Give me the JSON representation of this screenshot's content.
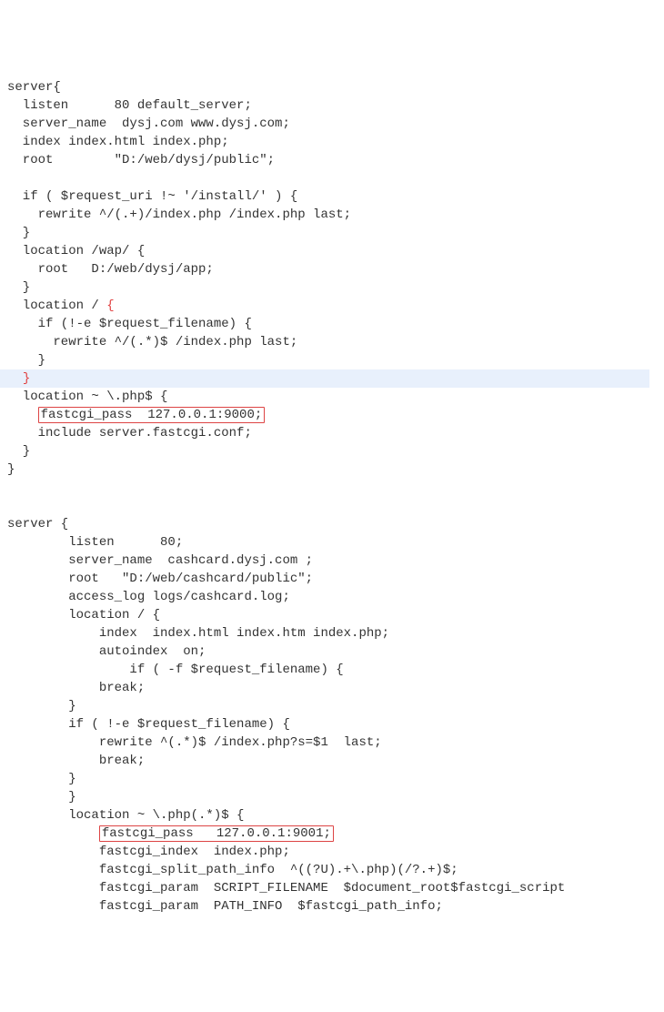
{
  "lines": [
    {
      "t": "server{"
    },
    {
      "t": "  listen      80 default_server;"
    },
    {
      "t": "  server_name  dysj.com www.dysj.com;"
    },
    {
      "t": "  index index.html index.php;"
    },
    {
      "t": "  root        \"D:/web/dysj/public\";"
    },
    {
      "t": ""
    },
    {
      "t": "  if ( $request_uri !~ '/install/' ) {"
    },
    {
      "t": "    rewrite ^/(.+)/index.php /index.php last;"
    },
    {
      "t": "  }"
    },
    {
      "t": "  location /wap/ {"
    },
    {
      "t": "    root   D:/web/dysj/app;"
    },
    {
      "t": "  }"
    },
    {
      "t": "  location / ",
      "after": "{",
      "afterClass": "red-brace"
    },
    {
      "t": "    if (!-e $request_filename) {"
    },
    {
      "t": "      rewrite ^/(.*)$ /index.php last;"
    },
    {
      "t": "    }"
    },
    {
      "t": "  ",
      "after": "}",
      "afterClass": "red-brace",
      "highlight": true
    },
    {
      "t": "  location ~ \\.php$ {"
    },
    {
      "prefix": "    ",
      "boxed": "fastcgi_pass  127.0.0.1:9000;"
    },
    {
      "t": "    include server.fastcgi.conf;"
    },
    {
      "t": "  }"
    },
    {
      "t": "}"
    },
    {
      "t": ""
    },
    {
      "t": ""
    },
    {
      "t": "server {"
    },
    {
      "t": "        listen      80;"
    },
    {
      "t": "        server_name  cashcard.dysj.com ;"
    },
    {
      "t": "        root   \"D:/web/cashcard/public\";"
    },
    {
      "t": "        access_log logs/cashcard.log;"
    },
    {
      "t": "        location / {"
    },
    {
      "t": "            index  index.html index.htm index.php;"
    },
    {
      "t": "            autoindex  on;"
    },
    {
      "t": "                if ( -f $request_filename) {"
    },
    {
      "t": "            break;"
    },
    {
      "t": "        }"
    },
    {
      "t": "        if ( !-e $request_filename) {"
    },
    {
      "t": "            rewrite ^(.*)$ /index.php?s=$1  last;"
    },
    {
      "t": "            break;"
    },
    {
      "t": "        }"
    },
    {
      "t": "        }"
    },
    {
      "t": "        location ~ \\.php(.*)$ {"
    },
    {
      "prefix": "            ",
      "boxed": "fastcgi_pass   127.0.0.1:9001;"
    },
    {
      "t": "            fastcgi_index  index.php;"
    },
    {
      "t": "            fastcgi_split_path_info  ^((?U).+\\.php)(/?.+)$;"
    },
    {
      "t": "            fastcgi_param  SCRIPT_FILENAME  $document_root$fastcgi_script"
    },
    {
      "t": "            fastcgi_param  PATH_INFO  $fastcgi_path_info;"
    }
  ]
}
